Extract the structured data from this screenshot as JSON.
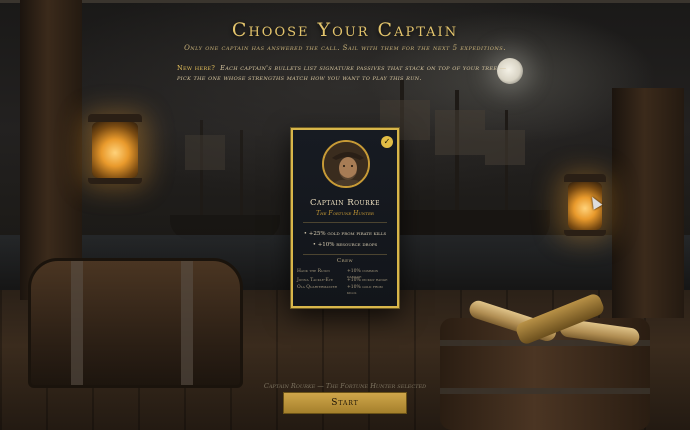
{
  "screen": {
    "title": "Choose Your Captain",
    "subtitle": "Only one captain has answered the call. Sail with them for the next 5 expeditions.",
    "hint_tag": "New here?",
    "hint_text": "Each captain's bullets list signature passives that stack on top of your tree — pick the one whose strengths match how you want to play this run."
  },
  "captain_card": {
    "selected": true,
    "check_icon": "checkmark-icon",
    "portrait_icon": "captain-portrait",
    "name": "Captain Rourke",
    "title": "The Fortune Hunter",
    "passives": [
      "+25% gold from pirate kills",
      "+10% resource drops"
    ],
    "crew_heading": "Crew",
    "crew": [
      {
        "name": "Hank the Ruiun",
        "bonus": "+10% common damage"
      },
      {
        "name": "Jonna Tackle-Eye",
        "bonus": "+10% pickup range"
      },
      {
        "name": "Ola Quartermaster",
        "bonus": "+10% gold from kills"
      }
    ]
  },
  "status_text": "Captain Rourke — The Fortune Hunter selected",
  "start_button_label": "Start",
  "colors": {
    "accent_gold": "#e3c46c",
    "card_border": "#d8b64a",
    "button": "#c19a3f"
  }
}
